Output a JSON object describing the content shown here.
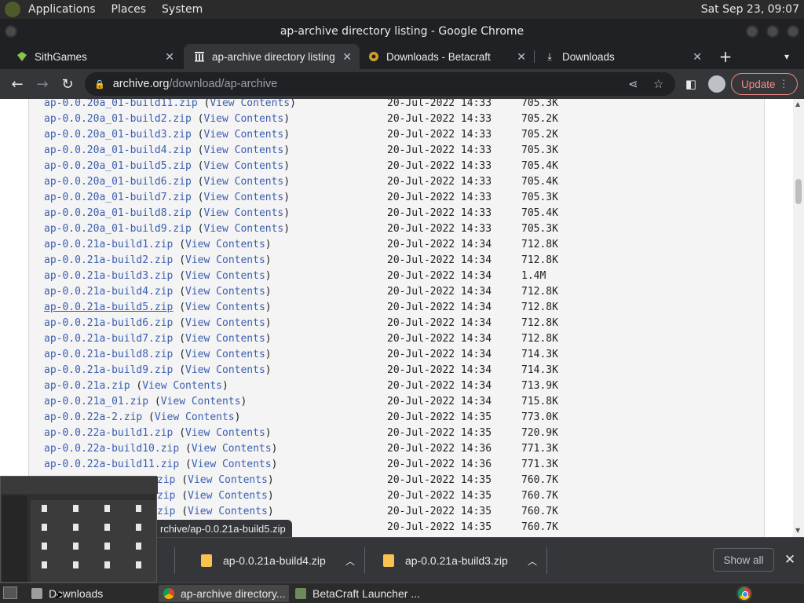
{
  "desktop": {
    "menus": [
      "Applications",
      "Places",
      "System"
    ],
    "clock": "Sat Sep 23, 09:07"
  },
  "window": {
    "title": "ap-archive directory listing - Google Chrome"
  },
  "tabs": [
    {
      "label": "SithGames",
      "icon": "sith-favicon",
      "active": false
    },
    {
      "label": "ap-archive directory listing",
      "icon": "archive-favicon",
      "active": true
    },
    {
      "label": "Downloads - Betacraft",
      "icon": "betacraft-favicon",
      "active": false
    },
    {
      "label": "Downloads",
      "icon": "download-icon",
      "active": false
    }
  ],
  "toolbar": {
    "url_host": "archive.org",
    "url_path": "/download/ap-archive",
    "update_label": "Update"
  },
  "listing": {
    "view_contents_label": "View Contents",
    "rows": [
      {
        "name": "ap-0.0.20a_01-build11.zip",
        "date": "20-Jul-2022 14:33",
        "size": "705.3K"
      },
      {
        "name": "ap-0.0.20a_01-build2.zip",
        "date": "20-Jul-2022 14:33",
        "size": "705.2K"
      },
      {
        "name": "ap-0.0.20a_01-build3.zip",
        "date": "20-Jul-2022 14:33",
        "size": "705.2K"
      },
      {
        "name": "ap-0.0.20a_01-build4.zip",
        "date": "20-Jul-2022 14:33",
        "size": "705.3K"
      },
      {
        "name": "ap-0.0.20a_01-build5.zip",
        "date": "20-Jul-2022 14:33",
        "size": "705.4K"
      },
      {
        "name": "ap-0.0.20a_01-build6.zip",
        "date": "20-Jul-2022 14:33",
        "size": "705.4K"
      },
      {
        "name": "ap-0.0.20a_01-build7.zip",
        "date": "20-Jul-2022 14:33",
        "size": "705.3K"
      },
      {
        "name": "ap-0.0.20a_01-build8.zip",
        "date": "20-Jul-2022 14:33",
        "size": "705.4K"
      },
      {
        "name": "ap-0.0.20a_01-build9.zip",
        "date": "20-Jul-2022 14:33",
        "size": "705.3K"
      },
      {
        "name": "ap-0.0.21a-build1.zip",
        "date": "20-Jul-2022 14:34",
        "size": "712.8K"
      },
      {
        "name": "ap-0.0.21a-build2.zip",
        "date": "20-Jul-2022 14:34",
        "size": "712.8K"
      },
      {
        "name": "ap-0.0.21a-build3.zip",
        "date": "20-Jul-2022 14:34",
        "size": "1.4M"
      },
      {
        "name": "ap-0.0.21a-build4.zip",
        "date": "20-Jul-2022 14:34",
        "size": "712.8K"
      },
      {
        "name": "ap-0.0.21a-build5.zip",
        "date": "20-Jul-2022 14:34",
        "size": "712.8K",
        "hovered": true
      },
      {
        "name": "ap-0.0.21a-build6.zip",
        "date": "20-Jul-2022 14:34",
        "size": "712.8K"
      },
      {
        "name": "ap-0.0.21a-build7.zip",
        "date": "20-Jul-2022 14:34",
        "size": "712.8K"
      },
      {
        "name": "ap-0.0.21a-build8.zip",
        "date": "20-Jul-2022 14:34",
        "size": "714.3K"
      },
      {
        "name": "ap-0.0.21a-build9.zip",
        "date": "20-Jul-2022 14:34",
        "size": "714.3K"
      },
      {
        "name": "ap-0.0.21a.zip",
        "date": "20-Jul-2022 14:34",
        "size": "713.9K"
      },
      {
        "name": "ap-0.0.21a_01.zip",
        "date": "20-Jul-2022 14:34",
        "size": "715.8K"
      },
      {
        "name": "ap-0.0.22a-2.zip",
        "date": "20-Jul-2022 14:35",
        "size": "773.0K"
      },
      {
        "name": "ap-0.0.22a-build1.zip",
        "date": "20-Jul-2022 14:35",
        "size": "720.9K"
      },
      {
        "name": "ap-0.0.22a-build10.zip",
        "date": "20-Jul-2022 14:36",
        "size": "771.3K"
      },
      {
        "name": "ap-0.0.22a-build11.zip",
        "date": "20-Jul-2022 14:36",
        "size": "771.3K"
      },
      {
        "name": "zip",
        "date": "20-Jul-2022 14:35",
        "size": "760.7K"
      },
      {
        "name": "zip",
        "date": "20-Jul-2022 14:35",
        "size": "760.7K"
      },
      {
        "name": "zip",
        "date": "20-Jul-2022 14:35",
        "size": "760.7K"
      },
      {
        "name": "",
        "date": "20-Jul-2022 14:35",
        "size": "760.7K"
      }
    ]
  },
  "status_link": "rchive/ap-0.0.21a-build5.zip",
  "downloads": {
    "items": [
      "ap-0.0.21a-build4.zip",
      "ap-0.0.21a-build3.zip"
    ],
    "show_all_label": "Show all"
  },
  "taskbar": {
    "items": [
      {
        "label": "Downloads",
        "icon": "folder-icon",
        "active": false
      },
      {
        "label": "ap-archive directory...",
        "icon": "chrome-icon",
        "active": true
      },
      {
        "label": "BetaCraft Launcher ...",
        "icon": "betacraft-icon",
        "active": false
      }
    ]
  }
}
